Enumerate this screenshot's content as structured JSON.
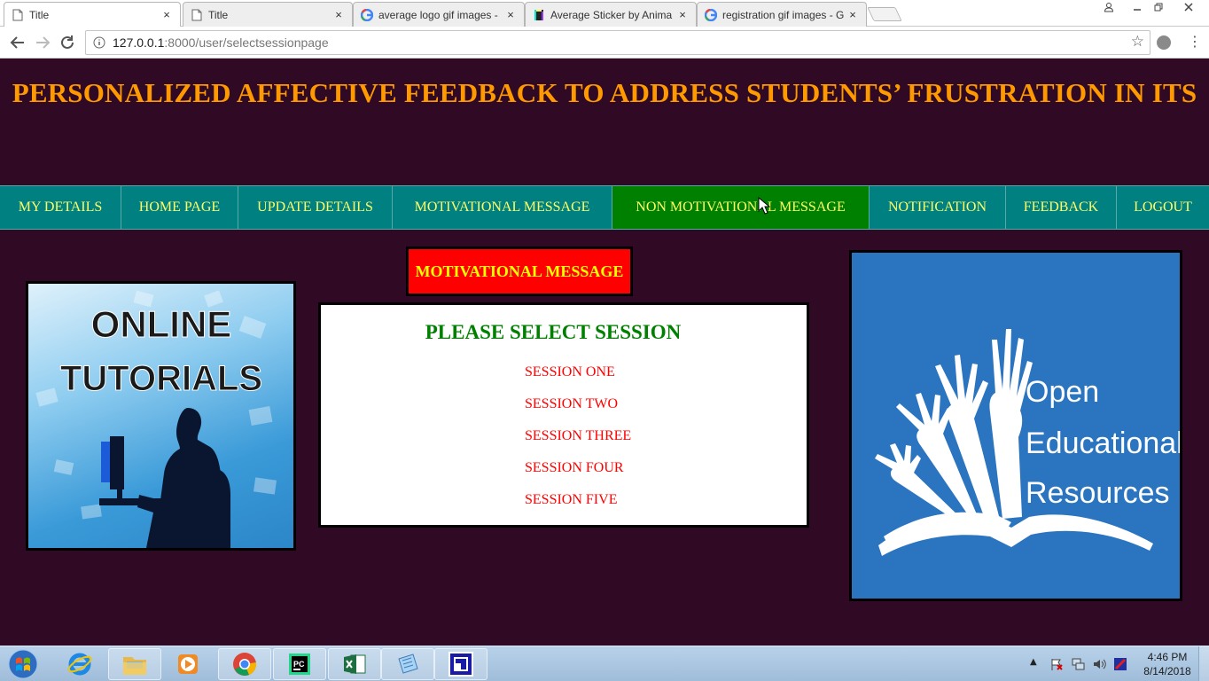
{
  "browser": {
    "tabs": [
      {
        "title": "Title",
        "icon": "page-icon",
        "active": true
      },
      {
        "title": "Title",
        "icon": "page-icon",
        "active": false
      },
      {
        "title": "average logo gif images - ",
        "icon": "google-icon",
        "active": false
      },
      {
        "title": "Average Sticker by Anima",
        "icon": "giphy-icon",
        "active": false
      },
      {
        "title": "registration gif images - G",
        "icon": "google-icon",
        "active": false
      }
    ],
    "close_glyph": "×",
    "url_host": "127.0.0.1",
    "url_path": ":8000/user/selectsessionpage"
  },
  "page": {
    "title": "PERSONALIZED AFFECTIVE FEEDBACK TO ADDRESS STUDENTS’ FRUSTRATION IN ITS",
    "nav": [
      {
        "label": "MY DETAILS"
      },
      {
        "label": "HOME PAGE"
      },
      {
        "label": "UPDATE DETAILS"
      },
      {
        "label": "MOTIVATIONAL MESSAGE"
      },
      {
        "label": "NON MOTIVATIONAL MESSAGE"
      },
      {
        "label": "NOTIFICATION"
      },
      {
        "label": "FEEDBACK"
      },
      {
        "label": "LOGOUT"
      }
    ],
    "active_nav": "NON MOTIVATIONAL MESSAGE",
    "section_button": "MOTIVATIONAL MESSAGE",
    "session_heading": "PLEASE SELECT SESSION",
    "sessions": [
      "SESSION ONE",
      "SESSION TWO",
      "SESSION THREE",
      "SESSION FOUR",
      "SESSION FIVE"
    ],
    "left_image_text": {
      "line1": "ONLINE",
      "line2": "TUTORIALS"
    },
    "right_image_text": {
      "line1": "Open",
      "line2": "Educational",
      "line3": "Resources"
    }
  },
  "taskbar": {
    "apps": [
      "internet-explorer-icon",
      "file-explorer-icon",
      "media-player-icon",
      "chrome-icon",
      "pycharm-icon",
      "excel-icon",
      "notepad-icon",
      "remote-app-icon"
    ],
    "time": "4:46 PM",
    "date": "8/14/2018"
  },
  "colors": {
    "page_bg": "#300a24",
    "title": "#ff9900",
    "nav_bg": "#008080",
    "nav_active": "#008000",
    "nav_text": "#ffff66",
    "button_bg": "#ff0000",
    "button_text": "#ffff00",
    "heading": "#008000",
    "session_text": "#ff0000"
  }
}
